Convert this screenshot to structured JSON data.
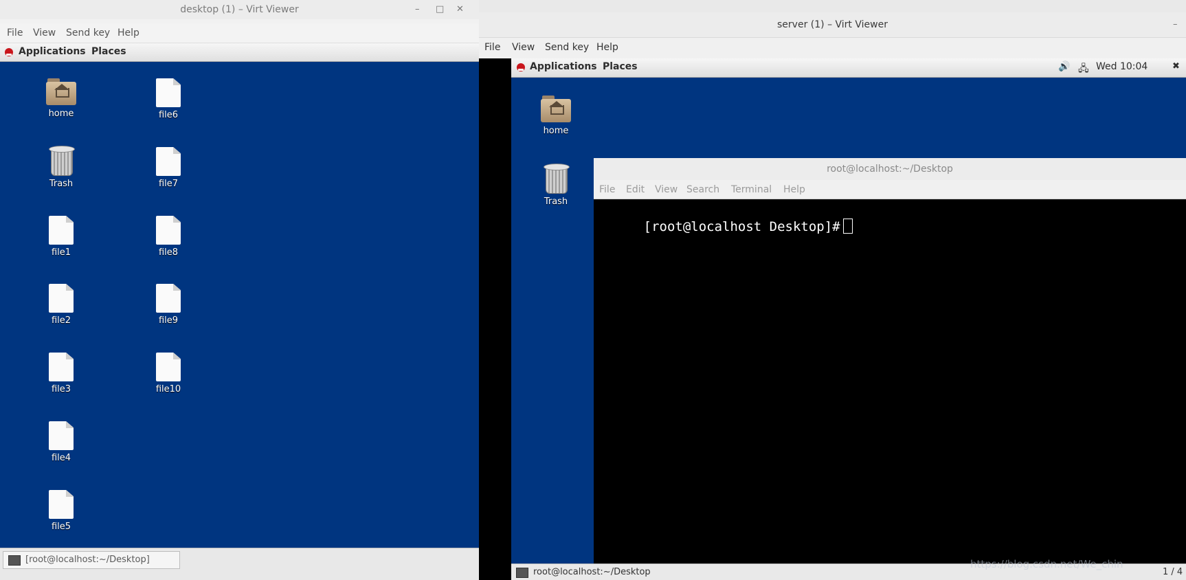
{
  "left_window": {
    "title": "desktop (1) – Virt Viewer",
    "menu": [
      "File",
      "View",
      "Send key",
      "Help"
    ],
    "gnome_bar": {
      "applications": "Applications",
      "places": "Places"
    },
    "desktop_icons": [
      {
        "label": "home",
        "type": "folder"
      },
      {
        "label": "Trash",
        "type": "trash"
      },
      {
        "label": "file1",
        "type": "file"
      },
      {
        "label": "file2",
        "type": "file"
      },
      {
        "label": "file3",
        "type": "file"
      },
      {
        "label": "file4",
        "type": "file"
      },
      {
        "label": "file5",
        "type": "file"
      },
      {
        "label": "file6",
        "type": "file"
      },
      {
        "label": "file7",
        "type": "file"
      },
      {
        "label": "file8",
        "type": "file"
      },
      {
        "label": "file9",
        "type": "file"
      },
      {
        "label": "file10",
        "type": "file"
      }
    ],
    "taskbar_item": "[root@localhost:~/Desktop]"
  },
  "right_window": {
    "title": "server (1) – Virt Viewer",
    "menu": [
      "File",
      "View",
      "Send key",
      "Help"
    ],
    "gnome_bar": {
      "applications": "Applications",
      "places": "Places",
      "clock": "Wed 10:04"
    },
    "desktop_icons": [
      {
        "label": "home",
        "type": "folder"
      },
      {
        "label": "Trash",
        "type": "trash"
      }
    ],
    "taskbar_item": "root@localhost:~/Desktop",
    "workspace": "1 / 4"
  },
  "terminal": {
    "title": "root@localhost:~/Desktop",
    "menu": [
      "File",
      "Edit",
      "View",
      "Search",
      "Terminal",
      "Help"
    ],
    "prompt": "[root@localhost Desktop]#"
  },
  "watermark": "https://blog.csdn.net/We_chin",
  "colors": {
    "desktop_bg": "#003580",
    "terminal_bg": "#000000"
  }
}
